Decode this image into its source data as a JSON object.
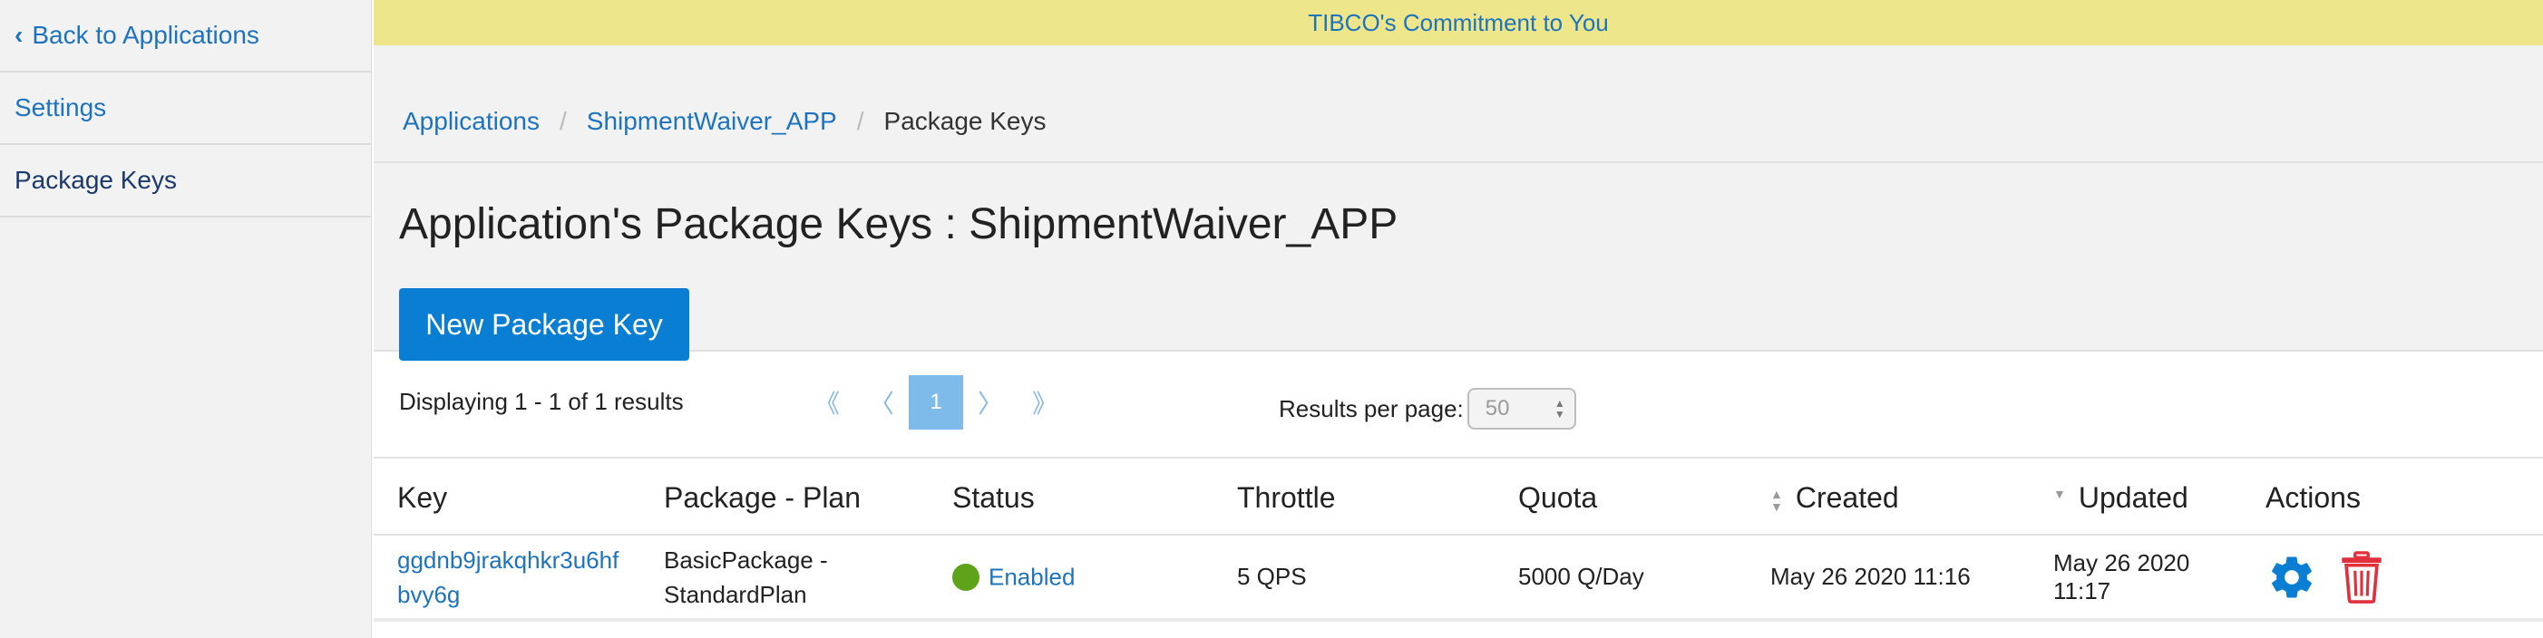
{
  "sidebar": {
    "back_label": "Back to Applications",
    "items": [
      {
        "label": "Settings"
      },
      {
        "label": "Package Keys"
      }
    ]
  },
  "banner": {
    "text": "TIBCO's Commitment to You"
  },
  "breadcrumb": [
    "Applications",
    "ShipmentWaiver_APP",
    "Package Keys"
  ],
  "page_title": "Application's Package Keys : ShipmentWaiver_APP",
  "new_key_button": "New Package Key",
  "pagination": {
    "display_text": "Displaying 1 - 1 of 1 results",
    "first": "《",
    "prev": "〈",
    "current_page": "1",
    "next": "〉",
    "last": "》",
    "results_per_page_label": "Results per page:",
    "results_per_page_value": "50"
  },
  "table": {
    "headers": {
      "key": "Key",
      "plan": "Package - Plan",
      "status": "Status",
      "throttle": "Throttle",
      "quota": "Quota",
      "created": "Created",
      "updated": "Updated",
      "actions": "Actions"
    },
    "rows": [
      {
        "key_line1": "ggdnb9jrakqhkr3u6hf",
        "key_line2": "bvy6g",
        "plan_line1": "BasicPackage -",
        "plan_line2": "StandardPlan",
        "status": "Enabled",
        "throttle": "5 QPS",
        "quota": "5000 Q/Day",
        "created": "May 26 2020 11:16",
        "updated": "May 26 2020 11:17",
        "actions": [
          "gear-icon",
          "trash-icon"
        ]
      }
    ]
  },
  "colors": {
    "link": "#1e73be",
    "primary": "#0a7ed3",
    "banner": "#ede68a",
    "status_enabled": "#5fa31a",
    "delete": "#e0303b"
  }
}
